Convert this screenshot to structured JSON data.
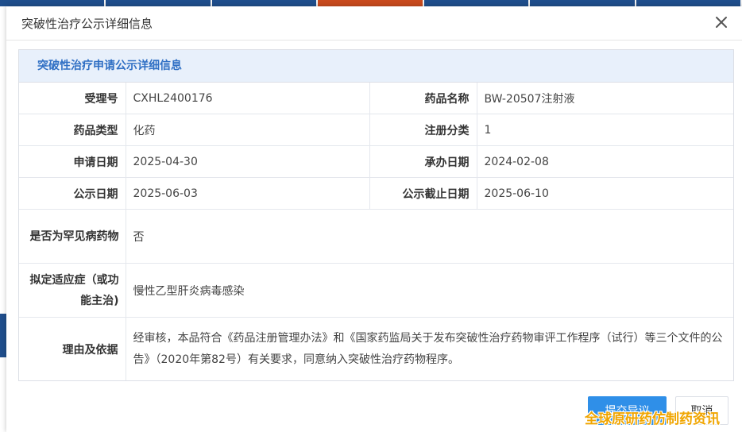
{
  "dialog": {
    "title": "突破性治疗公示详细信息",
    "close_icon": "close-icon"
  },
  "panel": {
    "heading": "突破性治疗申请公示详细信息"
  },
  "fields": {
    "acceptance_no": {
      "label": "受理号",
      "value": "CXHL2400176"
    },
    "drug_name": {
      "label": "药品名称",
      "value": "BW-20507注射液"
    },
    "drug_type": {
      "label": "药品类型",
      "value": "化药"
    },
    "registration_class": {
      "label": "注册分类",
      "value": "1"
    },
    "apply_date": {
      "label": "申请日期",
      "value": "2025-04-30"
    },
    "handling_date": {
      "label": "承办日期",
      "value": "2024-02-08"
    },
    "publish_date": {
      "label": "公示日期",
      "value": "2025-06-03"
    },
    "publish_deadline": {
      "label": "公示截止日期",
      "value": "2025-06-10"
    },
    "rare_disease": {
      "label": "是否为罕见病药物",
      "value": "否"
    },
    "indication": {
      "label": "拟定适应症（或功能主治)",
      "value": "慢性乙型肝炎病毒感染"
    },
    "reason": {
      "label": "理由及依据",
      "value": "经审核，本品符合《药品注册管理办法》和《国家药监局关于发布突破性治疗药物审评工作程序（试行）等三个文件的公告》（2020年第82号）有关要求，同意纳入突破性治疗药物程序。"
    }
  },
  "buttons": {
    "submit_label": "提交异议",
    "cancel_label": "取消"
  },
  "watermark": "全球原研药仿制药资讯",
  "colors": {
    "accent": "#2f8fe8",
    "panel_heading": "#2f6fc4",
    "panel_heading_bg": "#e8f0fb",
    "nav_bg": "#1f4e8c",
    "nav_active": "#c94a1e",
    "watermark": "#f0a500"
  }
}
